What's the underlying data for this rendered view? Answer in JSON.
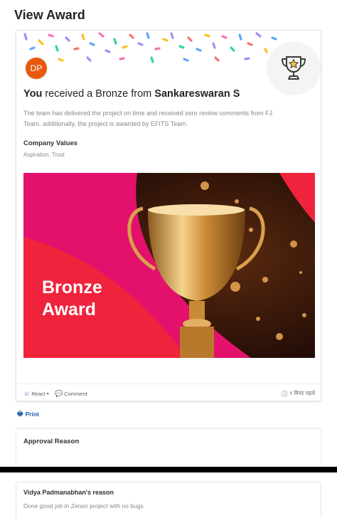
{
  "page": {
    "title": "View Award"
  },
  "award": {
    "avatar_initials": "DP",
    "headline_you": "You",
    "headline_middle": " received a Bronze from ",
    "headline_sender": "Sankareswaran S",
    "description": "The team has delivered the project on time and received zero review comments from FJ Team. additionally, the project is awarded by EFITS Team.",
    "values_label": "Company Values",
    "values": "Aspiration, Trust",
    "banner_line1": "Bronze",
    "banner_line2": "Award"
  },
  "actions": {
    "react_label": "React",
    "comment_label": "Comment",
    "timestamp": "९ मिनट पहले"
  },
  "print_label": "Print",
  "approval": {
    "title": "Approval Reason"
  },
  "reason": {
    "title": "Vidya Padmanabhan's reason",
    "text": "Done good job in Zenon project with no bugs"
  },
  "icons": {
    "trophy": "trophy-star-icon",
    "react": "smiley-icon",
    "comment": "speech-bubble-icon",
    "time": "clock-icon",
    "print": "printer-icon"
  },
  "colors": {
    "avatar": "#e8590c",
    "link": "#1f5fa8",
    "banner_pink": "#e3116c",
    "banner_red": "#f0233c"
  }
}
